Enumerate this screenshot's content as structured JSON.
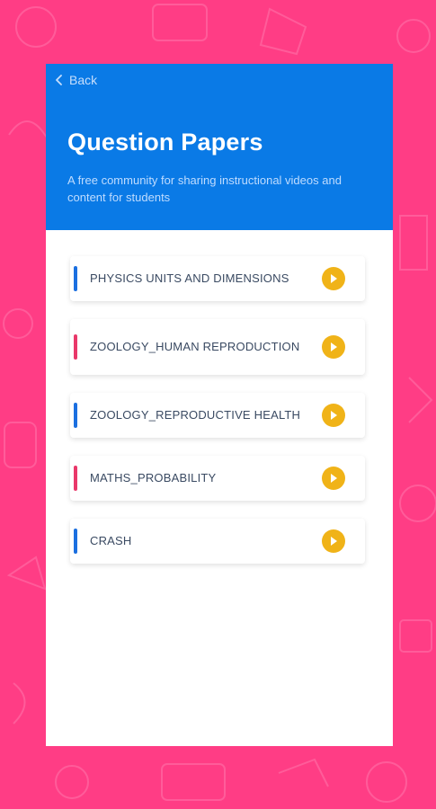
{
  "colors": {
    "background": "#ff3d85",
    "header": "#0a7ae6",
    "accent_blue": "#1b6fe0",
    "accent_pink": "#e9386a",
    "play_button": "#f0b318"
  },
  "header": {
    "back_label": "Back",
    "title": "Question Papers",
    "subtitle": "A free community for sharing instructional videos and content for students"
  },
  "papers": [
    {
      "label": "PHYSICS UNITS AND DIMENSIONS",
      "accent": "blue",
      "icon": "play-icon"
    },
    {
      "label": "ZOOLOGY_HUMAN REPRODUCTION",
      "accent": "pink",
      "icon": "play-icon"
    },
    {
      "label": "ZOOLOGY_REPRODUCTIVE HEALTH",
      "accent": "blue",
      "icon": "play-icon"
    },
    {
      "label": "MATHS_PROBABILITY",
      "accent": "pink",
      "icon": "play-icon"
    },
    {
      "label": "CRASH",
      "accent": "blue",
      "icon": "play-icon"
    }
  ]
}
